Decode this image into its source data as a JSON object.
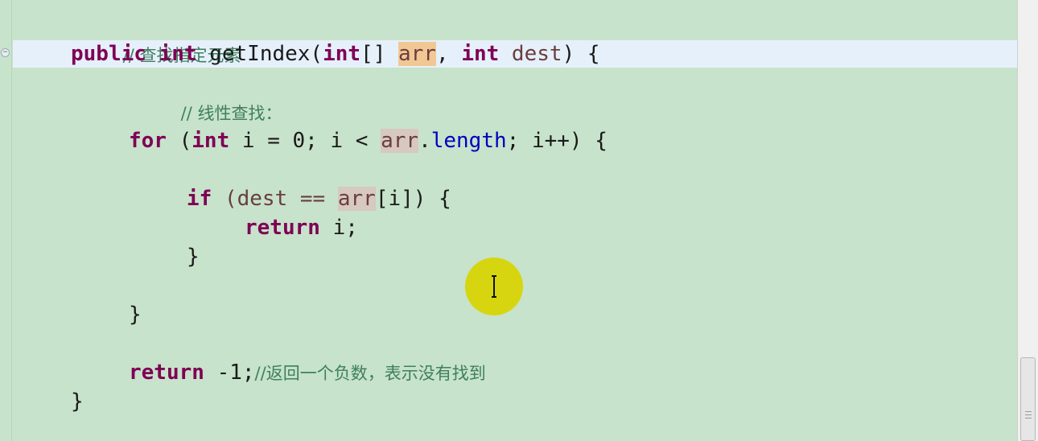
{
  "editor": {
    "lines": {
      "l1": {
        "comment": "// 查找指定元素"
      },
      "l2": {
        "kw_public": "public",
        "kw_int": "int",
        "method": " getIndex(",
        "kw_int2": "int",
        "bracket": "[] ",
        "param_arr": "arr",
        "comma": ", ",
        "kw_int3": "int",
        "param_dest": " dest",
        "close": ") {"
      },
      "l3": {
        "comment": "// 线性查找："
      },
      "l4": {
        "kw_for": "for",
        "open": " (",
        "kw_int": "int",
        "init": " i = 0; i < ",
        "arr": "arr",
        "dot": ".",
        "length": "length",
        "rest": "; i++) {"
      },
      "l5": {
        "kw_if": "if",
        "cond": " (dest == ",
        "arr": "arr",
        "rest": "[i]) {"
      },
      "l6": {
        "kw_return": "return",
        "rest": " i;"
      },
      "l7": {
        "text": "}"
      },
      "l8": {
        "text": "}"
      },
      "l9": {
        "kw_return": "return",
        "rest": " -1;",
        "comment": "//返回一个负数，表示没有找到"
      },
      "l10": {
        "text": "}"
      }
    }
  },
  "icons": {
    "fold": "minus-fold-icon",
    "cursor": "text-ibeam-cursor-icon"
  },
  "colors": {
    "background": "#c7e3cb",
    "keyword": "#7f0055",
    "comment": "#3f7f5f",
    "field": "#0000c0",
    "current_line": "#e6f0fb",
    "cursor_highlight": "#d8d400"
  }
}
